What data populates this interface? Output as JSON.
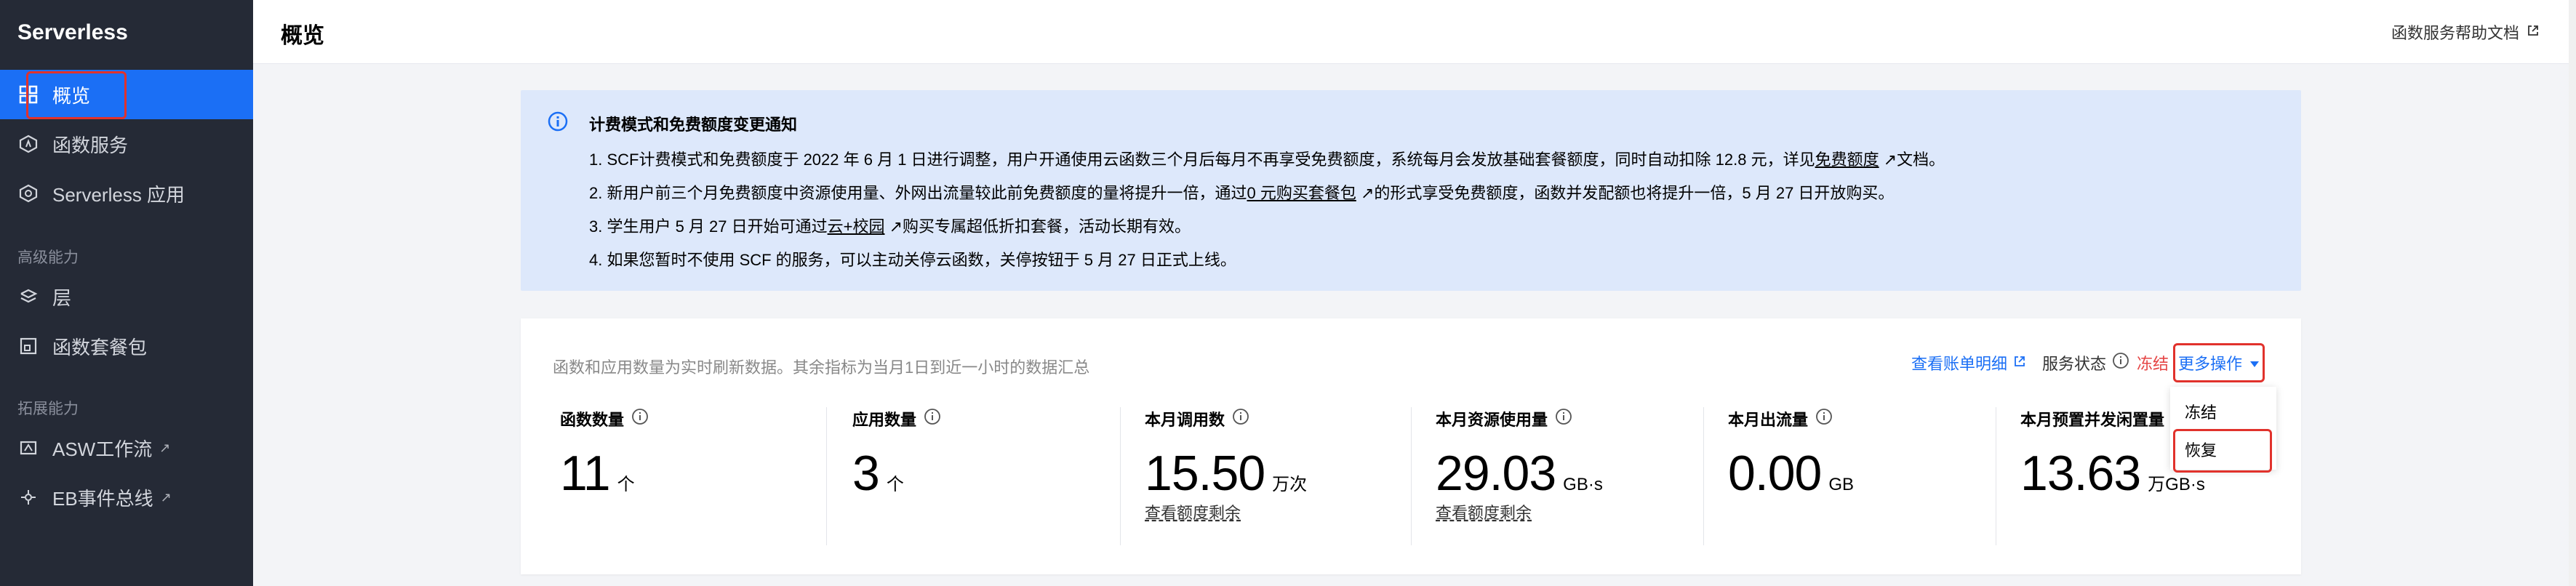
{
  "sidebar": {
    "brand": "Serverless",
    "items": [
      {
        "label": "概览",
        "icon": "grid-icon",
        "active": true
      },
      {
        "label": "函数服务",
        "icon": "function-icon"
      },
      {
        "label": "Serverless 应用",
        "icon": "app-icon"
      }
    ],
    "group_advanced": "高级能力",
    "advanced_items": [
      {
        "label": "层",
        "icon": "layers-icon"
      },
      {
        "label": "函数套餐包",
        "icon": "package-icon"
      }
    ],
    "group_extend": "拓展能力",
    "extend_items": [
      {
        "label": "ASW工作流",
        "icon": "workflow-icon"
      },
      {
        "label": "EB事件总线",
        "icon": "event-bus-icon"
      }
    ]
  },
  "header": {
    "title": "概览",
    "help_link": "函数服务帮助文档"
  },
  "notice": {
    "title": "计费模式和免费额度变更通知",
    "line1_pre": "1. SCF计费模式和免费额度于 2022 年 6 月 1 日进行调整，用户开通使用云函数三个月后每月不再享受免费额度，系统每月会发放基础套餐额度，同时自动扣除 12.8 元，详见",
    "line1_link": "免费额度",
    "line1_post": "文档。",
    "line2_pre": "2. 新用户前三个月免费额度中资源使用量、外网出流量较此前免费额度的量将提升一倍，通过",
    "line2_link": "0 元购买套餐包",
    "line2_post": "的形式享受免费额度，函数并发配额也将提升一倍，5 月 27 日开放购买。",
    "line3_pre": "3. 学生用户 5 月 27 日开始可通过",
    "line3_link": "云+校园",
    "line3_post": "购买专属超低折扣套餐，活动长期有效。",
    "line4": "4. 如果您暂时不使用 SCF 的服务，可以主动关停云函数，关停按钮于 5 月 27 日正式上线。"
  },
  "panel": {
    "description": "函数和应用数量为实时刷新数据。其余指标为当月1日到近一小时的数据汇总",
    "bill_link": "查看账单明细",
    "service_status_label": "服务状态",
    "service_status_value": "冻结",
    "more_actions": "更多操作",
    "dropdown": [
      "冻结",
      "恢复"
    ]
  },
  "metrics": [
    {
      "label": "函数数量",
      "value": "11",
      "unit": "个",
      "sub": ""
    },
    {
      "label": "应用数量",
      "value": "3",
      "unit": "个",
      "sub": ""
    },
    {
      "label": "本月调用数",
      "value": "15.50",
      "unit": "万次",
      "sub": "查看额度剩余"
    },
    {
      "label": "本月资源使用量",
      "value": "29.03",
      "unit": "GB·s",
      "sub": "查看额度剩余"
    },
    {
      "label": "本月出流量",
      "value": "0.00",
      "unit": "GB",
      "sub": ""
    },
    {
      "label": "本月预置并发闲置量",
      "value": "13.63",
      "unit": "万GB·s",
      "sub": ""
    }
  ],
  "colors": {
    "sidebar_bg": "#252a36",
    "active_blue": "#1b6ff5",
    "notice_bg": "#dde8fb",
    "frozen_red": "#e54545",
    "annotation_red": "#e1322c"
  }
}
